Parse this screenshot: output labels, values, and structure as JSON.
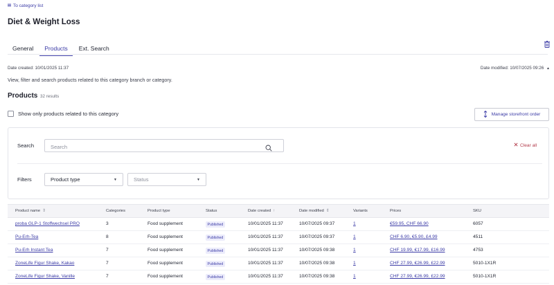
{
  "header": {
    "back_link": "To category list",
    "title": "Diet & Weight Loss"
  },
  "tabs": [
    {
      "label": "General"
    },
    {
      "label": "Products"
    },
    {
      "label": "Ext. Search"
    }
  ],
  "active_tab": "Products",
  "meta": {
    "date_created": "Date created: 10/01/2025 11:37",
    "date_modified": "Date modified: 10/07/2025 09:26",
    "description": "View, filter and search products related to this category branch or category."
  },
  "products": {
    "heading": "Products",
    "results": "32 results",
    "only_category_label": "Show only products related to this category",
    "only_category_checked": false,
    "manage_order_label": "Manage storefront order"
  },
  "search": {
    "label": "Search",
    "placeholder": "Search",
    "value": "",
    "clear_all": "Clear all"
  },
  "filters": {
    "label": "Filters",
    "product_type": "Product type",
    "status": "Status"
  },
  "table": {
    "columns": [
      "Product name",
      "Categories",
      "Product type",
      "Status",
      "Date created",
      "Date modified",
      "Variants",
      "Prices",
      "SKU"
    ],
    "rows": [
      {
        "name": "proba GLP-1 Stoffwechsel PRO",
        "categories": "3",
        "type": "Food supplement",
        "status": "Published",
        "created": "10/01/2025 11:37",
        "modified": "10/07/2025 09:37",
        "variants": "1",
        "prices": "€59.95, CHF 66.90",
        "sku": "6057"
      },
      {
        "name": "Pu-Erh-Tea",
        "categories": "8",
        "type": "Food supplement",
        "status": "Published",
        "created": "10/01/2025 11:37",
        "modified": "10/07/2025 09:37",
        "variants": "1",
        "prices": "CHF 6.90, €5.90, £4.99",
        "sku": "4511"
      },
      {
        "name": "Pu-Erh Instant Tea",
        "categories": "7",
        "type": "Food supplement",
        "status": "Published",
        "created": "10/01/2025 11:37",
        "modified": "10/07/2025 09:38",
        "variants": "1",
        "prices": "CHF 19.99, €17.99, £16.99",
        "sku": "4753"
      },
      {
        "name": "ZoneLife Figur Shake, Kakao",
        "categories": "7",
        "type": "Food supplement",
        "status": "Published",
        "created": "10/01/2025 11:37",
        "modified": "10/07/2025 09:38",
        "variants": "1",
        "prices": "CHF 27.99, €26.99, £22.99",
        "sku": "5010-1X1R"
      },
      {
        "name": "ZoneLife Figur Shake, Vanille",
        "categories": "7",
        "type": "Food supplement",
        "status": "Published",
        "created": "10/01/2025 11:37",
        "modified": "10/07/2025 09:38",
        "variants": "1",
        "prices": "CHF 27.99, €26.99, £22.99",
        "sku": "5010-1X1R"
      }
    ]
  },
  "colors": {
    "accent": "#3b3ba6",
    "danger": "#b23a4a",
    "badge_bg": "#ececfb"
  },
  "icons": [
    "list-icon",
    "trash-icon",
    "sort-arrows-icon",
    "search-icon",
    "close-icon",
    "chevron-down-icon"
  ]
}
